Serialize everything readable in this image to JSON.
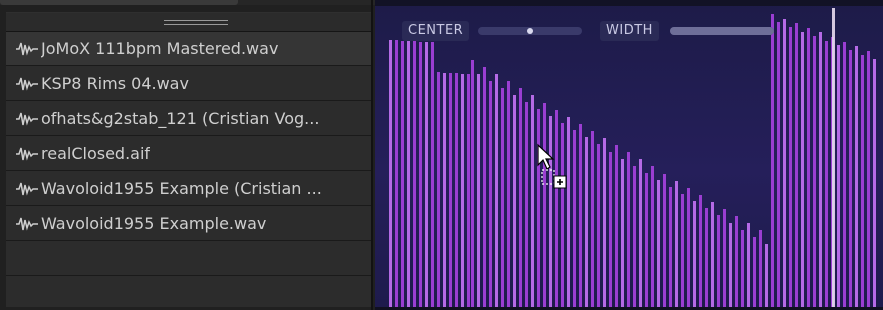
{
  "browser": {
    "files": [
      {
        "name": "JoMoX 111bpm Mastered.wav",
        "icon": "waveform-icon"
      },
      {
        "name": "KSP8 Rims 04.wav",
        "icon": "waveform-icon"
      },
      {
        "name": "ofhats&g2stab_121 (Cristian Vog...",
        "icon": "waveform-icon"
      },
      {
        "name": "realClosed.aif",
        "icon": "waveform-icon"
      },
      {
        "name": "Wavoloid1955 Example (Cristian ...",
        "icon": "waveform-icon"
      },
      {
        "name": "Wavoloid1955 Example.wav",
        "icon": "waveform-icon"
      }
    ]
  },
  "waveform": {
    "center_label": "CENTER",
    "width_label": "WIDTH",
    "center_value": 0.5,
    "width_value": 1.0,
    "bar_color": "#9a3ed2",
    "bar_color_bright": "#b56ae6",
    "background_color": "#221d54"
  },
  "cursor": {
    "icon": "drag-copy-cursor-icon"
  }
}
